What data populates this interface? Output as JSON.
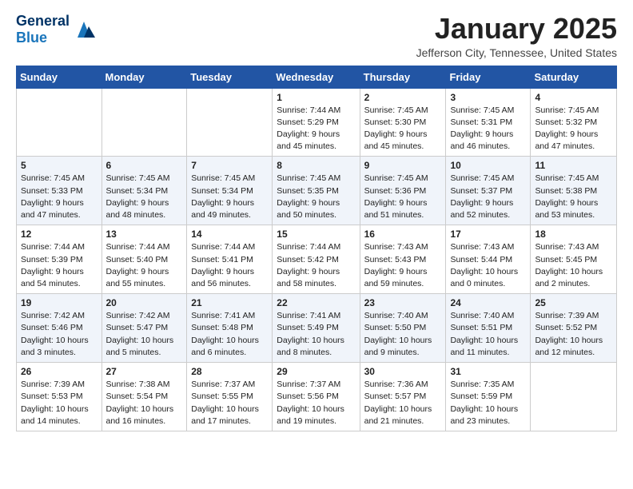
{
  "header": {
    "logo_general": "General",
    "logo_blue": "Blue",
    "month": "January 2025",
    "location": "Jefferson City, Tennessee, United States"
  },
  "weekdays": [
    "Sunday",
    "Monday",
    "Tuesday",
    "Wednesday",
    "Thursday",
    "Friday",
    "Saturday"
  ],
  "weeks": [
    [
      {
        "day": "",
        "info": ""
      },
      {
        "day": "",
        "info": ""
      },
      {
        "day": "",
        "info": ""
      },
      {
        "day": "1",
        "info": "Sunrise: 7:44 AM\nSunset: 5:29 PM\nDaylight: 9 hours\nand 45 minutes."
      },
      {
        "day": "2",
        "info": "Sunrise: 7:45 AM\nSunset: 5:30 PM\nDaylight: 9 hours\nand 45 minutes."
      },
      {
        "day": "3",
        "info": "Sunrise: 7:45 AM\nSunset: 5:31 PM\nDaylight: 9 hours\nand 46 minutes."
      },
      {
        "day": "4",
        "info": "Sunrise: 7:45 AM\nSunset: 5:32 PM\nDaylight: 9 hours\nand 47 minutes."
      }
    ],
    [
      {
        "day": "5",
        "info": "Sunrise: 7:45 AM\nSunset: 5:33 PM\nDaylight: 9 hours\nand 47 minutes."
      },
      {
        "day": "6",
        "info": "Sunrise: 7:45 AM\nSunset: 5:34 PM\nDaylight: 9 hours\nand 48 minutes."
      },
      {
        "day": "7",
        "info": "Sunrise: 7:45 AM\nSunset: 5:34 PM\nDaylight: 9 hours\nand 49 minutes."
      },
      {
        "day": "8",
        "info": "Sunrise: 7:45 AM\nSunset: 5:35 PM\nDaylight: 9 hours\nand 50 minutes."
      },
      {
        "day": "9",
        "info": "Sunrise: 7:45 AM\nSunset: 5:36 PM\nDaylight: 9 hours\nand 51 minutes."
      },
      {
        "day": "10",
        "info": "Sunrise: 7:45 AM\nSunset: 5:37 PM\nDaylight: 9 hours\nand 52 minutes."
      },
      {
        "day": "11",
        "info": "Sunrise: 7:45 AM\nSunset: 5:38 PM\nDaylight: 9 hours\nand 53 minutes."
      }
    ],
    [
      {
        "day": "12",
        "info": "Sunrise: 7:44 AM\nSunset: 5:39 PM\nDaylight: 9 hours\nand 54 minutes."
      },
      {
        "day": "13",
        "info": "Sunrise: 7:44 AM\nSunset: 5:40 PM\nDaylight: 9 hours\nand 55 minutes."
      },
      {
        "day": "14",
        "info": "Sunrise: 7:44 AM\nSunset: 5:41 PM\nDaylight: 9 hours\nand 56 minutes."
      },
      {
        "day": "15",
        "info": "Sunrise: 7:44 AM\nSunset: 5:42 PM\nDaylight: 9 hours\nand 58 minutes."
      },
      {
        "day": "16",
        "info": "Sunrise: 7:43 AM\nSunset: 5:43 PM\nDaylight: 9 hours\nand 59 minutes."
      },
      {
        "day": "17",
        "info": "Sunrise: 7:43 AM\nSunset: 5:44 PM\nDaylight: 10 hours\nand 0 minutes."
      },
      {
        "day": "18",
        "info": "Sunrise: 7:43 AM\nSunset: 5:45 PM\nDaylight: 10 hours\nand 2 minutes."
      }
    ],
    [
      {
        "day": "19",
        "info": "Sunrise: 7:42 AM\nSunset: 5:46 PM\nDaylight: 10 hours\nand 3 minutes."
      },
      {
        "day": "20",
        "info": "Sunrise: 7:42 AM\nSunset: 5:47 PM\nDaylight: 10 hours\nand 5 minutes."
      },
      {
        "day": "21",
        "info": "Sunrise: 7:41 AM\nSunset: 5:48 PM\nDaylight: 10 hours\nand 6 minutes."
      },
      {
        "day": "22",
        "info": "Sunrise: 7:41 AM\nSunset: 5:49 PM\nDaylight: 10 hours\nand 8 minutes."
      },
      {
        "day": "23",
        "info": "Sunrise: 7:40 AM\nSunset: 5:50 PM\nDaylight: 10 hours\nand 9 minutes."
      },
      {
        "day": "24",
        "info": "Sunrise: 7:40 AM\nSunset: 5:51 PM\nDaylight: 10 hours\nand 11 minutes."
      },
      {
        "day": "25",
        "info": "Sunrise: 7:39 AM\nSunset: 5:52 PM\nDaylight: 10 hours\nand 12 minutes."
      }
    ],
    [
      {
        "day": "26",
        "info": "Sunrise: 7:39 AM\nSunset: 5:53 PM\nDaylight: 10 hours\nand 14 minutes."
      },
      {
        "day": "27",
        "info": "Sunrise: 7:38 AM\nSunset: 5:54 PM\nDaylight: 10 hours\nand 16 minutes."
      },
      {
        "day": "28",
        "info": "Sunrise: 7:37 AM\nSunset: 5:55 PM\nDaylight: 10 hours\nand 17 minutes."
      },
      {
        "day": "29",
        "info": "Sunrise: 7:37 AM\nSunset: 5:56 PM\nDaylight: 10 hours\nand 19 minutes."
      },
      {
        "day": "30",
        "info": "Sunrise: 7:36 AM\nSunset: 5:57 PM\nDaylight: 10 hours\nand 21 minutes."
      },
      {
        "day": "31",
        "info": "Sunrise: 7:35 AM\nSunset: 5:59 PM\nDaylight: 10 hours\nand 23 minutes."
      },
      {
        "day": "",
        "info": ""
      }
    ]
  ]
}
